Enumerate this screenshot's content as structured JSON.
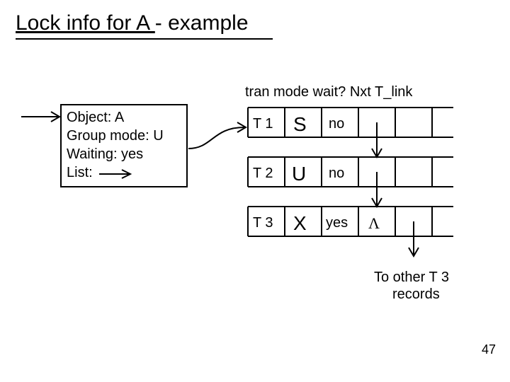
{
  "title_part1": "Lock info for A ",
  "title_part2": "- example",
  "boxLines": [
    "Object: A",
    "Group mode: U",
    "Waiting: yes",
    "List:"
  ],
  "columnsLine": "tran mode wait? Nxt T_link",
  "rows": [
    {
      "tran": "T 1",
      "mode": "S",
      "wait": "no",
      "lambda": ""
    },
    {
      "tran": "T 2",
      "mode": "U",
      "wait": "no",
      "lambda": ""
    },
    {
      "tran": "T 3",
      "mode": "X",
      "wait": "yes",
      "lambda": "Λ"
    }
  ],
  "footer1": "To other T 3",
  "footer2": "records",
  "page": "47"
}
